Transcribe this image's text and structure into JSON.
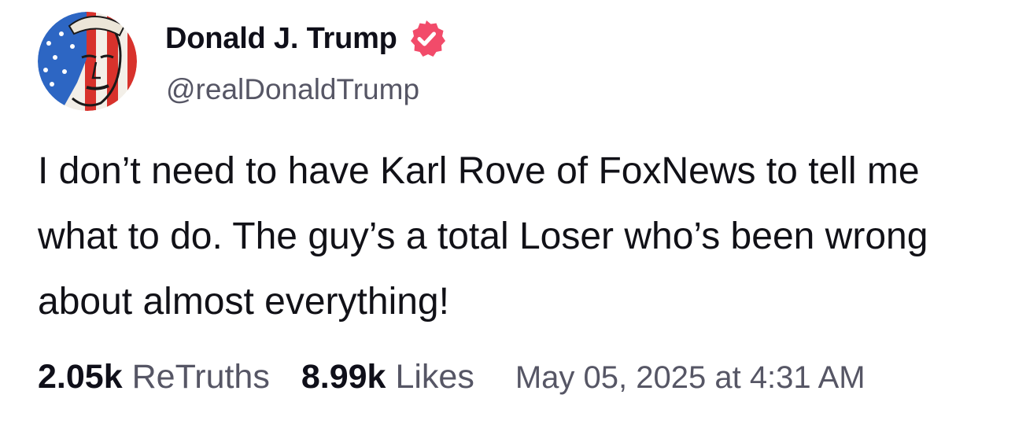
{
  "profile": {
    "display_name": "Donald J. Trump",
    "handle": "@realDonaldTrump",
    "verified_icon": "verified-badge-icon",
    "verified_color": "#f24b6a",
    "avatar": "avatar-image"
  },
  "post": {
    "text": "I don’t need to have Karl Rove of FoxNews to tell me what to do. The guy’s a total Loser who’s been wrong about almost everything!"
  },
  "stats": {
    "retruths_count": "2.05k",
    "retruths_label": "ReTruths",
    "likes_count": "8.99k",
    "likes_label": "Likes",
    "timestamp": "May 05, 2025 at 4:31 AM"
  }
}
